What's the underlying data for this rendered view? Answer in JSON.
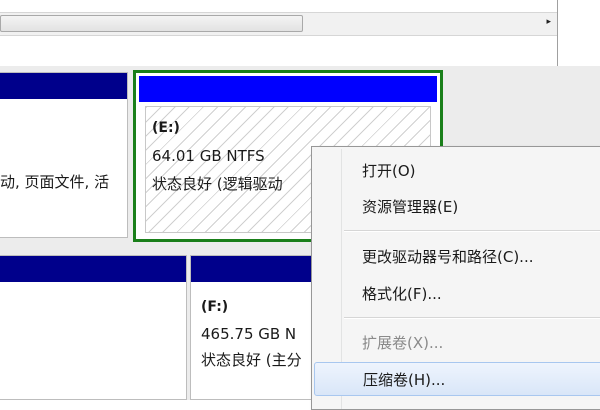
{
  "scrollbar": {
    "right_arrow": "▸"
  },
  "partitions": {
    "left_upper": {
      "status_fragment": "动, 页面文件, 活"
    },
    "e_drive": {
      "label": "(E:)",
      "size_fs": "64.01 GB NTFS",
      "status": "状态良好 (逻辑驱动"
    },
    "f_drive": {
      "label": "(F:)",
      "size_fs": "465.75 GB N",
      "status": "状态良好 (主分"
    }
  },
  "context_menu": {
    "items": [
      {
        "label": "打开(O)",
        "enabled": true
      },
      {
        "label": "资源管理器(E)",
        "enabled": true
      },
      {
        "label": "更改驱动器号和路径(C)...",
        "enabled": true
      },
      {
        "label": "格式化(F)...",
        "enabled": true
      },
      {
        "label": "扩展卷(X)...",
        "enabled": false
      },
      {
        "label": "压缩卷(H)...",
        "enabled": true,
        "highlighted": true
      }
    ]
  },
  "colors": {
    "primary_bar": "#00008b",
    "logical_bar": "#0000ff",
    "selection_border": "#1a7f1a"
  }
}
